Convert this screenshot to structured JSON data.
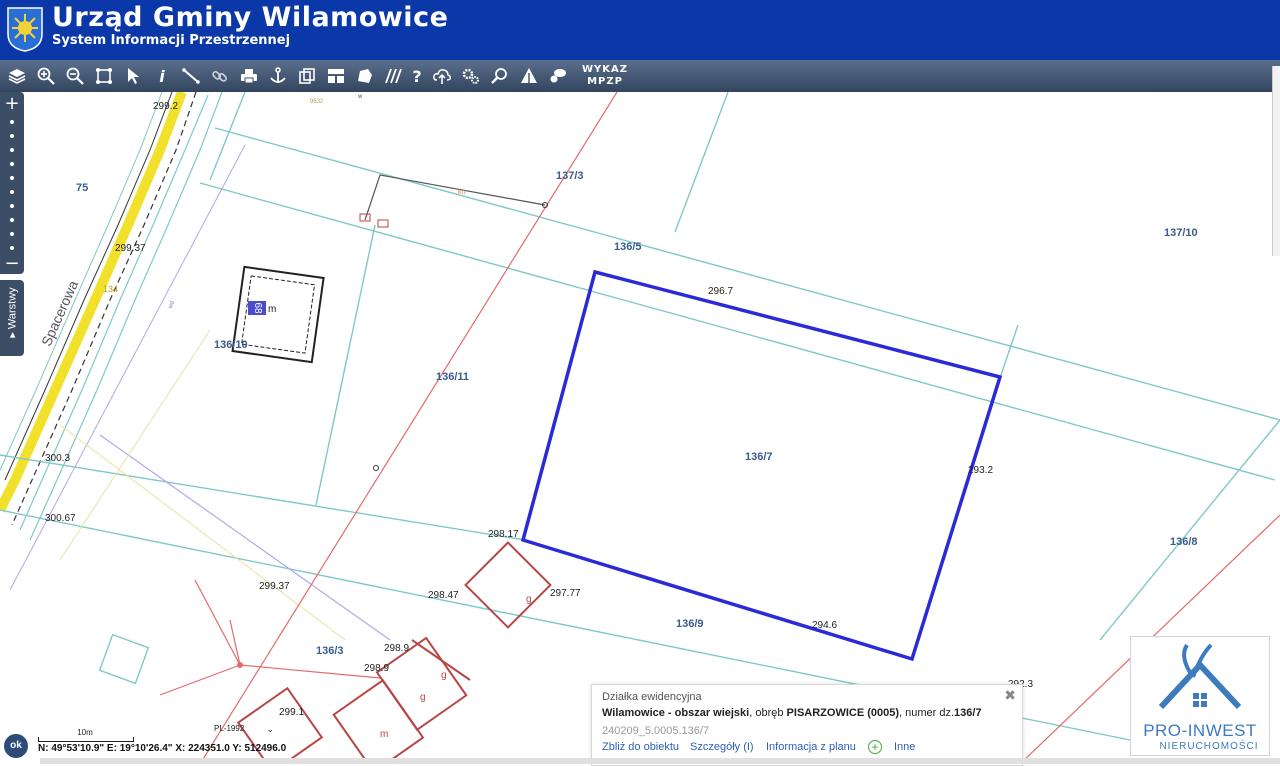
{
  "header": {
    "title": "Urząd Gminy Wilamowice",
    "subtitle": "System Informacji Przestrzennej"
  },
  "toolbar": {
    "icons": [
      "layers-icon",
      "zoom-in-icon",
      "zoom-out-icon",
      "zoom-extent-icon",
      "select-arrow-icon",
      "info-icon",
      "measure-icon",
      "link-icon",
      "print-icon",
      "anchor-icon",
      "copy-icon",
      "grid-layout-icon",
      "shape-icon",
      "hatch-icon",
      "help-icon",
      "cloud-upload-icon",
      "settings-icon",
      "search-icon",
      "warning-icon",
      "comment-icon"
    ],
    "wykaz_label_line1": "WYKAZ",
    "wykaz_label_line2": "MPZP"
  },
  "sidebar": {
    "zoom_in": "+",
    "zoom_out": "−",
    "layers_label": "▸ Warstwy"
  },
  "map": {
    "street_name": "Spacerowa",
    "parcels": [
      "75",
      "137/3",
      "136/5",
      "137/10",
      "136/10",
      "136/11",
      "136/7",
      "136/8",
      "136/9",
      "136/3"
    ],
    "building_label": "68",
    "building_type": "m",
    "elevations": [
      "299.2",
      "299.37",
      "300.3",
      "300.67",
      "299.37",
      "298.47",
      "298.17",
      "297.77",
      "296.7",
      "293.2",
      "294.6",
      "298.9",
      "298.9",
      "299.1",
      "292.3"
    ],
    "outbuilding_labels": [
      "g",
      "g",
      "g",
      "m"
    ],
    "small_labels": {
      "wd": "wd",
      "w": "w",
      "top_code": "9632",
      "road_width": "134"
    }
  },
  "info_panel": {
    "title": "Działka ewidencyjna",
    "place": "Wilamowice - obszar wiejski",
    "obreb_text": ", obręb ",
    "obreb": "PISARZOWICE (0005)",
    "numer_text": ", numer dz.",
    "numer": "136/7",
    "identifier": "240209_5.0005.136/7",
    "links": [
      "Zbliż do obiektu",
      "Szczegóły (I)",
      "Informacja z planu",
      "Inne"
    ],
    "close": "✖"
  },
  "status": {
    "scale_label": "10m",
    "projection": "PL-1992",
    "coords": "N: 49°53'10.9\"  E: 19°10'26.4\"  X: 224351.0  Y: 512496.0",
    "ok": "ok"
  },
  "logo": {
    "name": "PRO-INWEST",
    "subtitle": "NIERUCHOMOŚCI"
  },
  "colors": {
    "header_bg": "#0b38a8",
    "selection": "#2a2ad6",
    "parcel_line": "#7fc8c8",
    "road_yellow": "#f2e12a",
    "building_red": "#b84646"
  }
}
